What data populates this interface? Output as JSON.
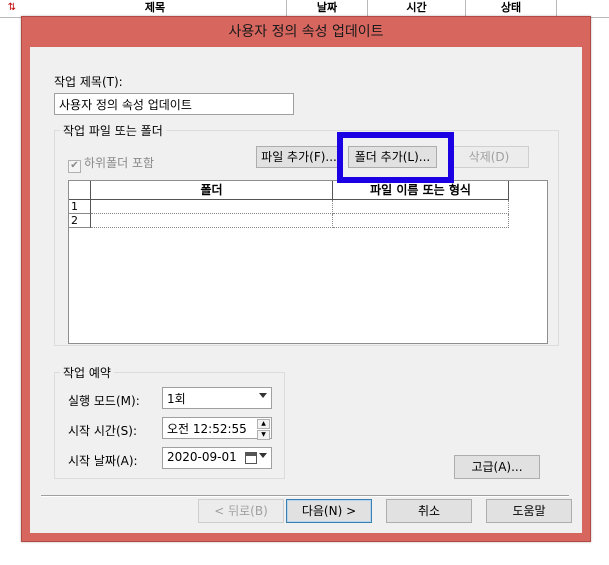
{
  "background_list": {
    "columns": [
      "제목",
      "날짜",
      "시간",
      "상태"
    ]
  },
  "dialog": {
    "title": "사용자 정의 속성 업데이트",
    "job_title_label": "작업 제목(T):",
    "job_title_value": "사용자 정의 속성 업데이트",
    "files_group": {
      "title": "작업 파일 또는 폴더",
      "include_subfolders": "하위폴더 포함",
      "include_subfolders_checked": true,
      "add_file_button": "파일 추가(F)...",
      "add_folder_button": "폴더 추가(L)...",
      "delete_button": "삭제(D)",
      "grid": {
        "col_folder": "폴더",
        "col_pattern": "파일 이름 또는 형식",
        "rows": [
          {
            "num": "1",
            "folder": "",
            "pattern": ""
          },
          {
            "num": "2",
            "folder": "",
            "pattern": ""
          }
        ]
      }
    },
    "schedule_group": {
      "title": "작업 예약",
      "run_mode_label": "실행 모드(M):",
      "run_mode_value": "1회",
      "start_time_label": "시작 시간(S):",
      "start_time_value": "오전 12:52:55",
      "start_date_label": "시작 날짜(A):",
      "start_date_value": "2020-09-01"
    },
    "advanced_button": "고급(A)...",
    "back_button": "< 뒤로(B)",
    "next_button": "다음(N) >",
    "cancel_button": "취소",
    "help_button": "도움말"
  },
  "colors": {
    "dialog_frame": "#d7665f",
    "highlight": "#1b00e3",
    "client_bg": "#f0f0f0"
  }
}
